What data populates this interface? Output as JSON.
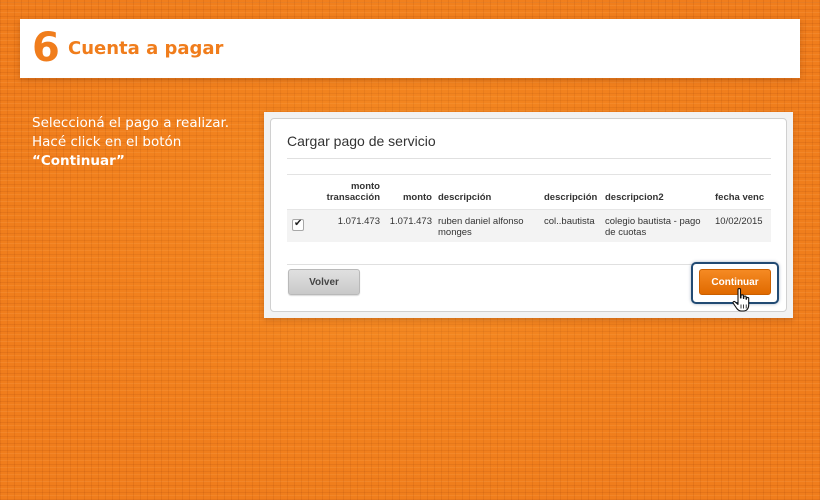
{
  "header": {
    "step_number": "6",
    "title": "Cuenta a pagar"
  },
  "instructions": {
    "line1": "Seleccioná el pago a realizar.",
    "line2": "Hacé click en el botón",
    "line3": "“Continuar”"
  },
  "panel": {
    "title": "Cargar pago de servicio",
    "table": {
      "columns": [
        {
          "line1": "monto",
          "line2": "transacción"
        },
        {
          "line1": "monto",
          "line2": ""
        },
        {
          "line1": "descripción",
          "line2": ""
        },
        {
          "line1": "descripción",
          "line2": ""
        },
        {
          "line1": "descripcion2",
          "line2": ""
        },
        {
          "line1": "fecha venc",
          "line2": ""
        }
      ],
      "rows": [
        {
          "checked": true,
          "checkmark": "✔",
          "monto_transaccion": "1.071.473",
          "monto": "1.071.473",
          "descripcion_a": "ruben daniel alfonso monges",
          "descripcion_b": "col..bautista",
          "descripcion2": "colegio bautista - pago de cuotas",
          "fecha_venc": "10/02/2015"
        }
      ]
    },
    "buttons": {
      "volver": "Volver",
      "continuar": "Continuar"
    }
  },
  "colors": {
    "brand_orange": "#f07d1c",
    "button_orange": "#f07a10",
    "highlight_blue": "#214a73"
  },
  "icons": {
    "checkbox": "check-icon",
    "cursor": "hand-pointer-icon"
  }
}
